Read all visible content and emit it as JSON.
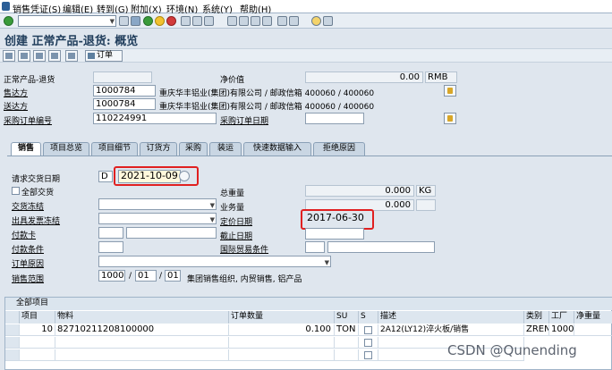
{
  "menu": [
    "销售凭证(S)",
    "编辑(E)",
    "转到(G)",
    "附加(X)",
    "环境(N)",
    "系统(Y)",
    "帮助(H)"
  ],
  "title": "创建 正常产品-退货: 概览",
  "app_toolbar": {
    "order_label": "订单"
  },
  "header": {
    "doc_type_label": "正常产品-退货",
    "net_value_label": "净价值",
    "net_value": "0.00",
    "currency": "RMB",
    "sold_to_label": "售达方",
    "sold_to_value": "1000784",
    "sold_to_desc": "重庆华丰铝业(集团)有限公司 / 邮政信箱 400060 / 400060",
    "ship_to_label": "送达方",
    "ship_to_value": "1000784",
    "ship_to_desc": "重庆华丰铝业(集团)有限公司 / 邮政信箱 400060 / 400060",
    "po_label": "采购订单编号",
    "po_value": "110224991",
    "po_date_label": "采购订单日期"
  },
  "tabs": [
    "销售",
    "项目总览",
    "项目细节",
    "订货方",
    "采购",
    "装运",
    "快速数据输入",
    "拒绝原因"
  ],
  "sales": {
    "req_date_label": "请求交货日期",
    "req_date_type": "D",
    "req_date": "2021-10-09",
    "complete_delivery_label": "全部交货",
    "delivery_block_label": "交货冻结",
    "billing_block_label": "出具发票冻结",
    "payment_card_label": "付款卡",
    "payment_terms_label": "付款条件",
    "order_reason_label": "订单原因",
    "sales_area_label": "销售范围",
    "sales_org": "1000",
    "dist_channel": "01",
    "division": "01",
    "sales_area_desc": "集团销售组织, 内贸销售, 铝产品",
    "total_weight_label": "总重量",
    "total_weight": "0.000",
    "weight_unit": "KG",
    "volume_label": "业务量",
    "volume": "0.000",
    "pricing_date_label": "定价日期",
    "pricing_date": "2017-06-30",
    "expiry_date_label": "截止日期",
    "incoterms_label": "国际贸易条件"
  },
  "items_table": {
    "title": "全部项目",
    "columns": [
      "项目",
      "物料",
      "订单数量",
      "SU",
      "S",
      "描述",
      "类别",
      "工厂",
      "净重量"
    ],
    "rows": [
      {
        "item": "10",
        "material": "82710211208100000",
        "qty": "0.100",
        "su": "TON",
        "s": "",
        "desc": "2A12(LY12)淬火板/销售",
        "category": "ZREN",
        "plant": "1000",
        "net_weight": ""
      }
    ]
  },
  "watermark": "CSDN @Qunending"
}
